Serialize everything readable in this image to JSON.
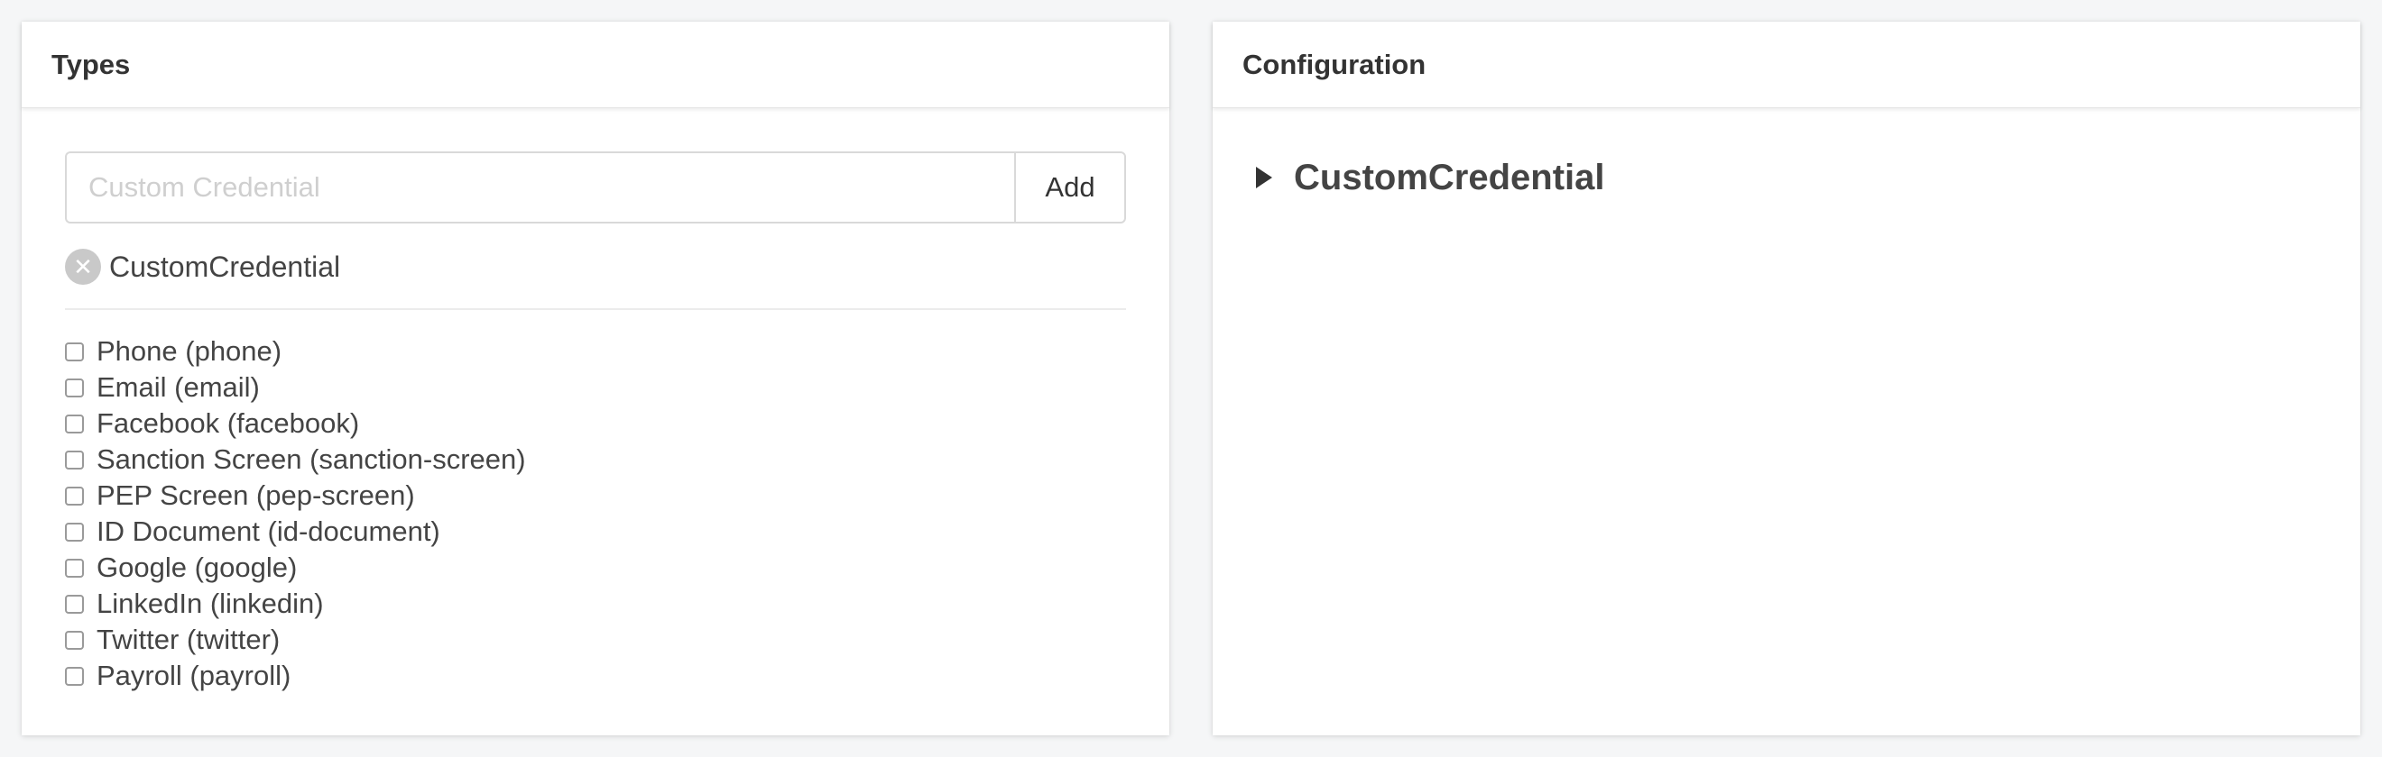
{
  "types_panel": {
    "title": "Types",
    "input": {
      "placeholder": "Custom Credential",
      "value": ""
    },
    "add_button_label": "Add",
    "custom_tags": [
      {
        "label": "CustomCredential",
        "remove_icon": "close-circle-icon"
      }
    ],
    "checkbox_items": [
      {
        "label": "Phone (phone)",
        "checked": false
      },
      {
        "label": "Email (email)",
        "checked": false
      },
      {
        "label": "Facebook (facebook)",
        "checked": false
      },
      {
        "label": "Sanction Screen (sanction-screen)",
        "checked": false
      },
      {
        "label": "PEP Screen (pep-screen)",
        "checked": false
      },
      {
        "label": "ID Document (id-document)",
        "checked": false
      },
      {
        "label": "Google (google)",
        "checked": false
      },
      {
        "label": "LinkedIn (linkedin)",
        "checked": false
      },
      {
        "label": "Twitter (twitter)",
        "checked": false
      },
      {
        "label": "Payroll (payroll)",
        "checked": false
      }
    ]
  },
  "configuration_panel": {
    "title": "Configuration",
    "tree_nodes": [
      {
        "label": "CustomCredential",
        "expanded": false,
        "icon": "caret-right-icon"
      }
    ]
  },
  "colors": {
    "background": "#f5f6f7",
    "panel": "#ffffff",
    "text": "#444444",
    "tag_remove": "#c9c9c9",
    "border": "#d9d9d9"
  }
}
